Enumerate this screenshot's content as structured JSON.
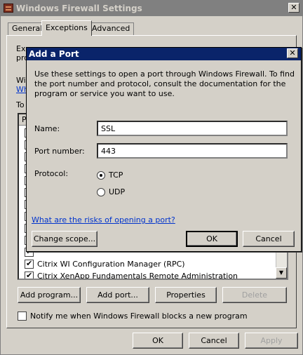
{
  "window": {
    "title": "Windows Firewall Settings",
    "close_label": "✕",
    "tabs": [
      {
        "label": "General"
      },
      {
        "label": "Exceptions"
      },
      {
        "label": "Advanced"
      }
    ],
    "partial_texts": [
      "Exc",
      "pro",
      "Wir",
      "Wh",
      "To"
    ],
    "list_header": "P",
    "list_items": [
      {
        "label": "Citrix WI Configuration Manager (RPC)",
        "checked": true
      },
      {
        "label": "Citrix XenApp Fundamentals Remote Administration",
        "checked": true
      }
    ],
    "buttons": {
      "add_program": "Add program...",
      "add_port": "Add port...",
      "properties": "Properties",
      "delete": "Delete"
    },
    "notify_label": "Notify me when Windows Firewall blocks a new program",
    "footer": {
      "ok": "OK",
      "cancel": "Cancel",
      "apply": "Apply"
    }
  },
  "dialog": {
    "title": "Add a Port",
    "close_label": "✕",
    "description": "Use these settings to open a port through Windows Firewall. To find the port number and protocol, consult the documentation for the program or service you want to use.",
    "name_label": "Name:",
    "name_value": "SSL",
    "port_label": "Port number:",
    "port_value": "443",
    "protocol_label": "Protocol:",
    "protocol_options": [
      {
        "label": "TCP",
        "selected": true
      },
      {
        "label": "UDP",
        "selected": false
      }
    ],
    "risk_link": "What are the risks of opening a port?",
    "change_scope": "Change scope...",
    "ok": "OK",
    "cancel": "Cancel"
  }
}
